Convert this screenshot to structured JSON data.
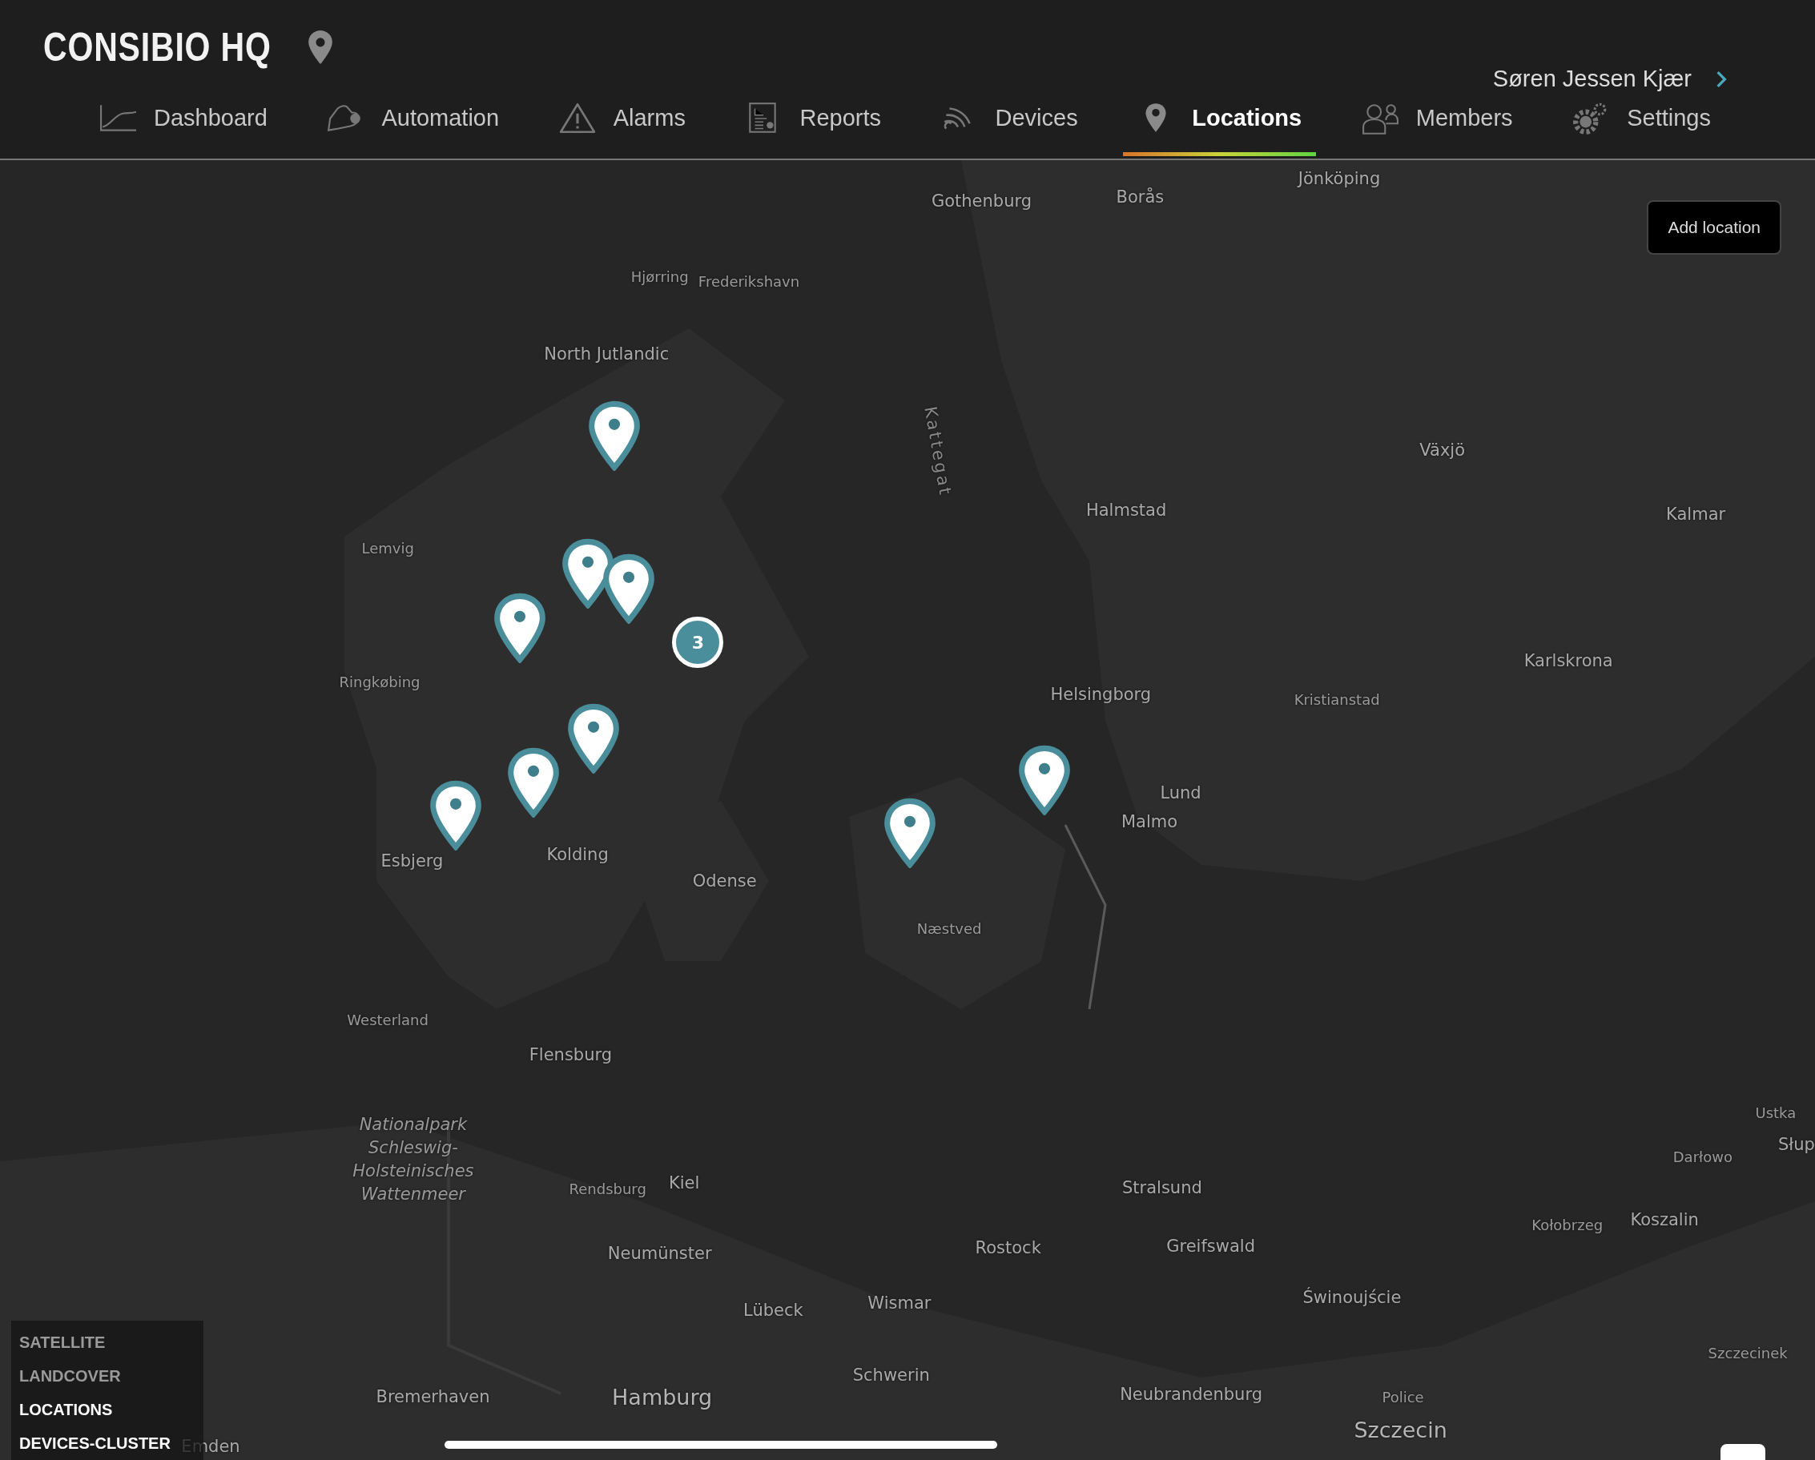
{
  "header": {
    "title": "CONSIBIO HQ",
    "user": "Søren Jessen Kjær"
  },
  "nav": [
    {
      "label": "Dashboard",
      "selected": false
    },
    {
      "label": "Automation",
      "selected": false
    },
    {
      "label": "Alarms",
      "selected": false
    },
    {
      "label": "Reports",
      "selected": false
    },
    {
      "label": "Devices",
      "selected": false
    },
    {
      "label": "Locations",
      "selected": true
    },
    {
      "label": "Members",
      "selected": false
    },
    {
      "label": "Settings",
      "selected": false
    }
  ],
  "map": {
    "add_button": "Add location",
    "labels": [
      {
        "text": "Gothenburg",
        "kind": "city"
      },
      {
        "text": "Borås",
        "kind": "city"
      },
      {
        "text": "Jönköping",
        "kind": "city"
      },
      {
        "text": "Hjørring",
        "kind": "town"
      },
      {
        "text": "Frederikshavn",
        "kind": "town"
      },
      {
        "text": "North Jutlandic",
        "kind": "city"
      },
      {
        "text": "Kattegat",
        "kind": "water"
      },
      {
        "text": "Lemvig",
        "kind": "town"
      },
      {
        "text": "Halmstad",
        "kind": "city"
      },
      {
        "text": "Växjö",
        "kind": "city"
      },
      {
        "text": "Kalmar",
        "kind": "city"
      },
      {
        "text": "Ringkøbing",
        "kind": "town"
      },
      {
        "text": "Helsingborg",
        "kind": "city"
      },
      {
        "text": "Kristianstad",
        "kind": "town"
      },
      {
        "text": "Karlskrona",
        "kind": "city"
      },
      {
        "text": "Lund",
        "kind": "city"
      },
      {
        "text": "Malmo",
        "kind": "city"
      },
      {
        "text": "Esbjerg",
        "kind": "city"
      },
      {
        "text": "Kolding",
        "kind": "city"
      },
      {
        "text": "Odense",
        "kind": "city"
      },
      {
        "text": "Næstved",
        "kind": "town"
      },
      {
        "text": "Westerland",
        "kind": "town"
      },
      {
        "text": "Flensburg",
        "kind": "city"
      },
      {
        "text": "Nationalpark Schleswig-Holsteinisches Wattenmeer",
        "kind": "park"
      },
      {
        "text": "Rendsburg",
        "kind": "town"
      },
      {
        "text": "Kiel",
        "kind": "city"
      },
      {
        "text": "Stralsund",
        "kind": "city"
      },
      {
        "text": "Ustka",
        "kind": "town"
      },
      {
        "text": "Słup",
        "kind": "city"
      },
      {
        "text": "Darłowo",
        "kind": "town"
      },
      {
        "text": "Kołobrzeg",
        "kind": "town"
      },
      {
        "text": "Koszalin",
        "kind": "city"
      },
      {
        "text": "Neumünster",
        "kind": "city"
      },
      {
        "text": "Rostock",
        "kind": "city"
      },
      {
        "text": "Greifswald",
        "kind": "city"
      },
      {
        "text": "Świnoujście",
        "kind": "city"
      },
      {
        "text": "Lübeck",
        "kind": "city"
      },
      {
        "text": "Wismar",
        "kind": "city"
      },
      {
        "text": "Schwerin",
        "kind": "city"
      },
      {
        "text": "Szczecinek",
        "kind": "town"
      },
      {
        "text": "Bremerhaven",
        "kind": "city"
      },
      {
        "text": "Hamburg",
        "kind": "major"
      },
      {
        "text": "Neubrandenburg",
        "kind": "city"
      },
      {
        "text": "Police",
        "kind": "town"
      },
      {
        "text": "Szczecin",
        "kind": "major"
      },
      {
        "text": "Emden",
        "kind": "city"
      }
    ],
    "markers": [
      {
        "kind": "pin"
      },
      {
        "kind": "pin"
      },
      {
        "kind": "pin"
      },
      {
        "kind": "pin"
      },
      {
        "kind": "cluster",
        "count": "3"
      },
      {
        "kind": "pin"
      },
      {
        "kind": "pin"
      },
      {
        "kind": "pin"
      },
      {
        "kind": "pin"
      },
      {
        "kind": "pin"
      }
    ],
    "layers": [
      {
        "label": "SATELLITE",
        "on": false
      },
      {
        "label": "LANDCOVER",
        "on": false
      },
      {
        "label": "LOCATIONS",
        "on": true
      },
      {
        "label": "DEVICES-CLUSTER",
        "on": true
      }
    ]
  }
}
